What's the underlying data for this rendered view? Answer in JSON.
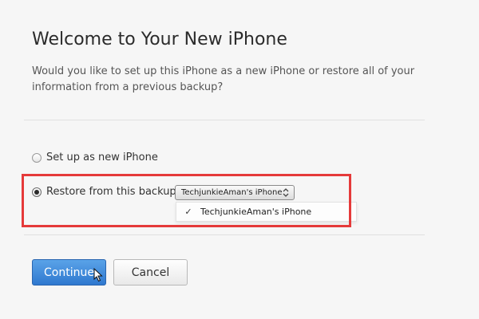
{
  "header": {
    "title": "Welcome to Your New iPhone",
    "subtitle": "Would you like to set up this iPhone as a new iPhone or restore all of your information from a previous backup?"
  },
  "options": {
    "new_iphone": {
      "label": "Set up as new iPhone",
      "selected": false
    },
    "restore": {
      "label": "Restore from this backup:",
      "selected": true
    }
  },
  "backup_select": {
    "value": "TechjunkieAman's iPhone",
    "options": [
      "TechjunkieAman's iPhone"
    ],
    "checked_option": "TechjunkieAman's iPhone"
  },
  "buttons": {
    "continue": "Continue",
    "cancel": "Cancel"
  },
  "icons": {
    "select_arrows": "chevron-up-down-icon",
    "check": "checkmark-icon",
    "cursor": "mouse-pointer-icon"
  },
  "colors": {
    "primary_button": "#3a86d8",
    "highlight_border": "#e53a3a",
    "background": "#f6f6f6"
  }
}
